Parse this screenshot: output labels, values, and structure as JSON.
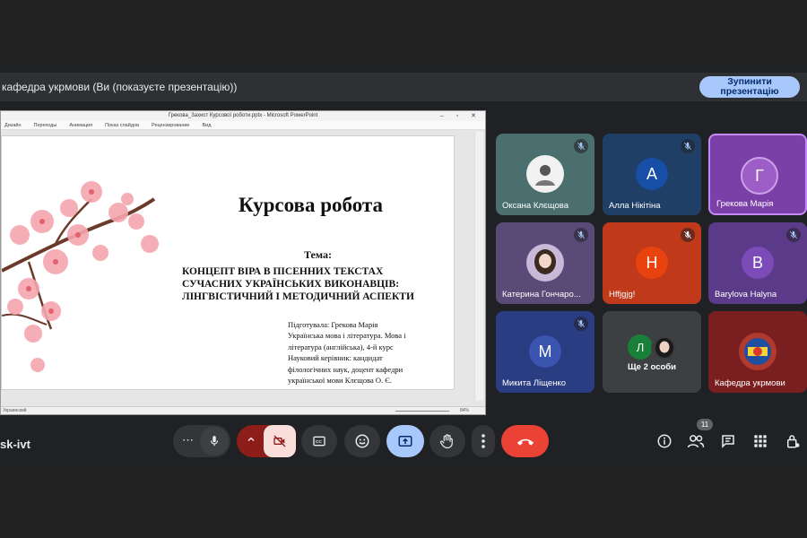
{
  "banner": {
    "text": "кафедра укрмови (Ви (показуєте презентацію))",
    "stop_label": "Зупинити презентацію"
  },
  "presentation_window": {
    "title": "Грекова_Захист Курсової роботи.pptx - Microsoft PowerPoint",
    "ribbon_tabs": [
      "Дизайн",
      "Переходы",
      "Анимация",
      "Показ слайдов",
      "Рецензирование",
      "Вид"
    ],
    "status_left": "Украинский",
    "zoom": "84%"
  },
  "slide": {
    "title": "Курсова робота",
    "theme_label": "Тема:",
    "topic": "КОНЦЕПТ ВІРА В ПІСЕННИХ ТЕКСТАХ\nСУЧАСНИХ УКРАЇНСЬКИХ ВИКОНАВЦІВ:\nЛІНГВІСТИЧНИЙ І МЕТОДИЧНИЙ АСПЕКТИ",
    "author": "Підготувала: Грекова Марія\nУкраїнська мова і література. Мова і\nлітература (англійська), 4-й курс\nНауковий керівник: кандидат\nфілологічних наук, доцент кафедри\nукраїнської мови Клєщова О. Є."
  },
  "participants": [
    {
      "name": "Оксана Клєщова",
      "muted": true,
      "color": "#4b6e6e",
      "avatar": "photo"
    },
    {
      "name": "Алла Нікітіна",
      "muted": true,
      "color": "#1f3f66",
      "avatar": "А",
      "avatar_color": "#174ea6"
    },
    {
      "name": "Грекова Марія",
      "muted": false,
      "color": "#7b3fa8",
      "avatar": "Г",
      "avatar_color": "#9c5dc7"
    },
    {
      "name": "Катерина Гончаро...",
      "muted": true,
      "color": "#5a4a78",
      "avatar": "photo"
    },
    {
      "name": "Hffjgjg!",
      "muted": true,
      "color": "#c0391b",
      "avatar": "Н",
      "avatar_color": "#e8430f"
    },
    {
      "name": "Barylova Halyna",
      "muted": true,
      "color": "#5b3a8a",
      "avatar": "В",
      "avatar_color": "#7b4cb8"
    },
    {
      "name": "Микита Ліщенко",
      "muted": true,
      "color": "#2a3d82",
      "avatar": "М",
      "avatar_color": "#3a54b0"
    },
    {
      "name": "Ще 2 особи",
      "muted": false,
      "color": "#3c4043",
      "avatar": "Л"
    },
    {
      "name": "Кафедра укрмови",
      "muted": false,
      "color": "#7a1f1f",
      "avatar": "logo"
    }
  ],
  "toolbar": {
    "meeting_code": "sk-ivt",
    "people_count": "11",
    "icons": [
      "more-options-icon",
      "mic-icon",
      "chevron-up-icon",
      "camera-off-icon",
      "captions-icon",
      "emoji-icon",
      "present-icon",
      "raise-hand-icon",
      "more-vert-icon",
      "end-call-icon",
      "info-icon",
      "people-icon",
      "chat-icon",
      "activities-icon",
      "host-controls-icon"
    ]
  },
  "colors": {
    "background": "#202124",
    "stop_button": "#a8c7fa",
    "end_call": "#ea4335",
    "camera_off": "#f9dedc",
    "present_active": "#a8c7fa"
  }
}
